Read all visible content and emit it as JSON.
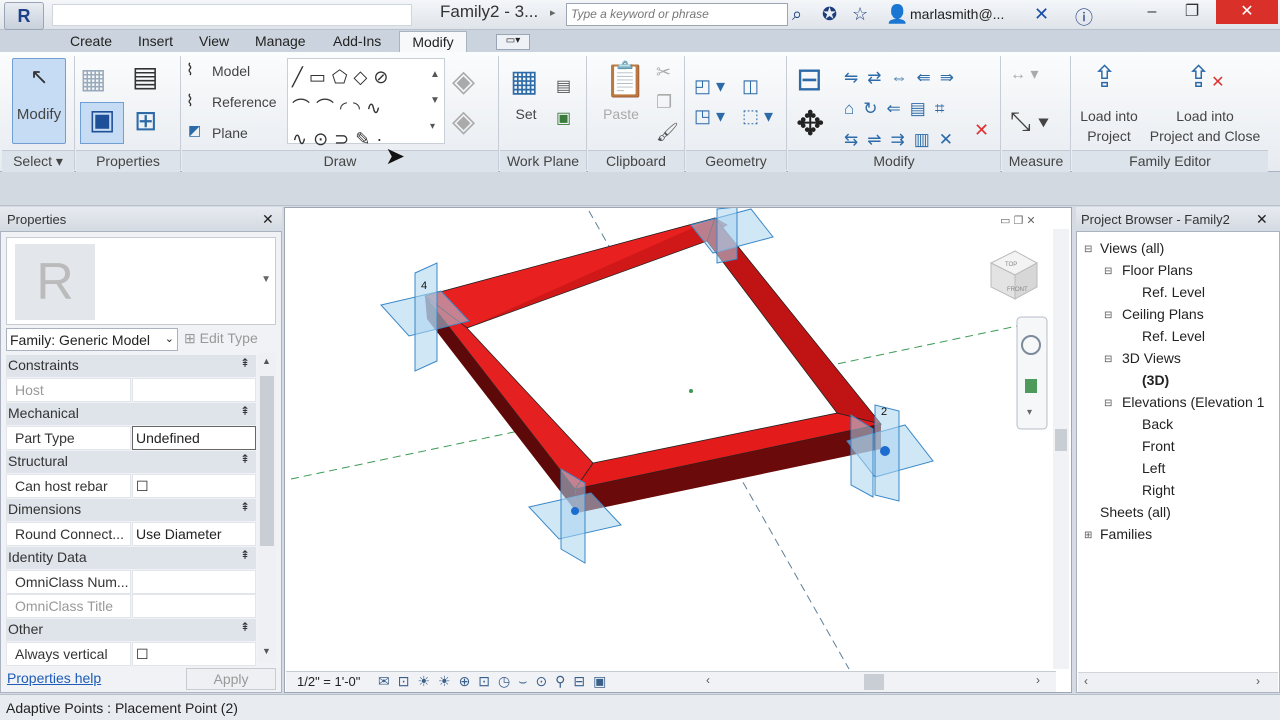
{
  "titlebar": {
    "app_logo": "R",
    "doc_title": "Family2 - 3...",
    "search_placeholder": "Type a keyword or phrase",
    "user": "marlasmith@...",
    "icons": [
      "binoculars-icon",
      "star-icon",
      "user-icon",
      "help-icon"
    ]
  },
  "tabs": [
    "Create",
    "Insert",
    "View",
    "Manage",
    "Add-Ins",
    "Modify"
  ],
  "ribbon": {
    "modify": "Modify",
    "select": "Select",
    "properties": "Properties",
    "draw_items": [
      "Model",
      "Reference",
      "Plane"
    ],
    "draw": "Draw",
    "set": "Set",
    "work_plane": "Work Plane",
    "paste": "Paste",
    "clipboard": "Clipboard",
    "geometry": "Geometry",
    "modify_panel": "Modify",
    "measure": "Measure",
    "load_into_project": [
      "Load into",
      "Project"
    ],
    "load_into_project_close": [
      "Load into",
      "Project and Close"
    ],
    "family_editor": "Family Editor"
  },
  "properties": {
    "title": "Properties",
    "family": "Family: Generic Model",
    "edit_type": "Edit Type",
    "groups": [
      {
        "name": "Constraints",
        "rows": [
          {
            "k": "Host",
            "v": "",
            "dim": true
          }
        ]
      },
      {
        "name": "Mechanical",
        "rows": [
          {
            "k": "Part Type",
            "v": "Undefined"
          }
        ]
      },
      {
        "name": "Structural",
        "rows": [
          {
            "k": "Can host rebar",
            "v": "☐"
          }
        ]
      },
      {
        "name": "Dimensions",
        "rows": [
          {
            "k": "Round Connect...",
            "v": "Use Diameter"
          }
        ]
      },
      {
        "name": "Identity Data",
        "rows": [
          {
            "k": "OmniClass Num...",
            "v": ""
          },
          {
            "k": "OmniClass Title",
            "v": "",
            "dim": true
          }
        ]
      },
      {
        "name": "Other",
        "rows": [
          {
            "k": "Always vertical",
            "v": "☐"
          }
        ]
      }
    ],
    "help": "Properties help",
    "apply": "Apply"
  },
  "viewport": {
    "scale": "1/2\" = 1'-0\"",
    "cube_top": "TOP",
    "cube_front": "FRONT",
    "point_labels": [
      "4",
      "2"
    ]
  },
  "browser": {
    "title": "Project Browser - Family2",
    "nodes": [
      {
        "label": "Views (all)",
        "level": 0,
        "toggle": "⊟"
      },
      {
        "label": "Floor Plans",
        "level": 1,
        "toggle": "⊟"
      },
      {
        "label": "Ref. Level",
        "level": 2
      },
      {
        "label": "Ceiling Plans",
        "level": 1,
        "toggle": "⊟"
      },
      {
        "label": "Ref. Level",
        "level": 2
      },
      {
        "label": "3D Views",
        "level": 1,
        "toggle": "⊟"
      },
      {
        "label": "(3D)",
        "level": 2,
        "bold": true
      },
      {
        "label": "Elevations (Elevation 1",
        "level": 1,
        "toggle": "⊟"
      },
      {
        "label": "Back",
        "level": 2
      },
      {
        "label": "Front",
        "level": 2
      },
      {
        "label": "Left",
        "level": 2
      },
      {
        "label": "Right",
        "level": 2
      },
      {
        "label": "Sheets (all)",
        "level": 0
      },
      {
        "label": "Families",
        "level": 0,
        "toggle": "⊞"
      }
    ]
  },
  "status": "Adaptive Points : Placement Point (2)"
}
